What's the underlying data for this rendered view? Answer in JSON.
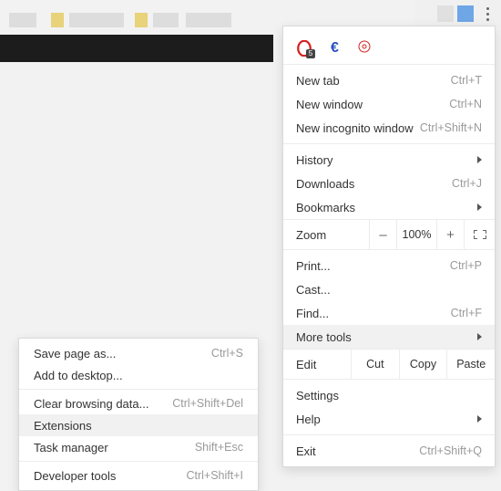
{
  "toolbar": {
    "extensions_badge": "5"
  },
  "menu": {
    "new_tab": "New tab",
    "new_tab_sc": "Ctrl+T",
    "new_window": "New window",
    "new_window_sc": "Ctrl+N",
    "incognito": "New incognito window",
    "incognito_sc": "Ctrl+Shift+N",
    "history": "History",
    "downloads": "Downloads",
    "downloads_sc": "Ctrl+J",
    "bookmarks": "Bookmarks",
    "zoom_label": "Zoom",
    "zoom_minus": "–",
    "zoom_value": "100%",
    "zoom_plus": "+",
    "print": "Print",
    "print_sc": "Ctrl+P",
    "cast": "Cast",
    "find": "Find",
    "find_sc": "Ctrl+F",
    "more_tools": "More tools",
    "edit_label": "Edit",
    "cut": "Cut",
    "copy": "Copy",
    "paste": "Paste",
    "settings": "Settings",
    "help": "Help",
    "exit": "Exit",
    "exit_sc": "Ctrl+Shift+Q"
  },
  "submenu": {
    "save_page": "Save page as",
    "save_page_sc": "Ctrl+S",
    "add_desktop": "Add to desktop",
    "clear_data": "Clear browsing data",
    "clear_data_sc": "Ctrl+Shift+Del",
    "extensions": "Extensions",
    "task_manager": "Task manager",
    "task_manager_sc": "Shift+Esc",
    "dev_tools": "Developer tools",
    "dev_tools_sc": "Ctrl+Shift+I"
  }
}
